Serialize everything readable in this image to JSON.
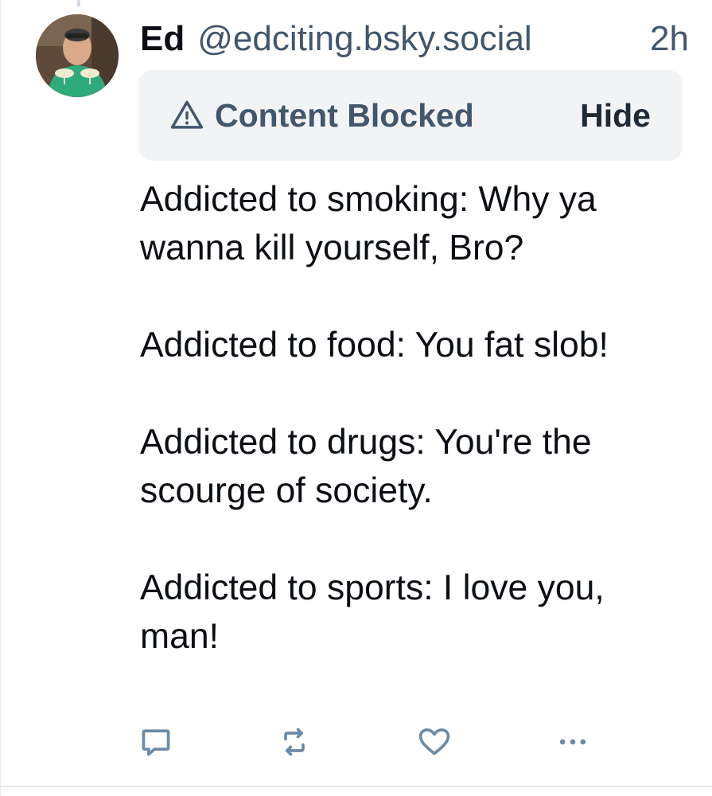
{
  "post": {
    "author": {
      "display_name": "Ed",
      "handle": "@edciting.bsky.social",
      "avatar_icon": "user-avatar-photo"
    },
    "time_ago": "2h",
    "moderation": {
      "label": "Content Blocked",
      "toggle_label": "Hide",
      "icon": "warning-triangle-icon",
      "background": "#f1f3f5",
      "text_color": "#42566c"
    },
    "paragraphs": [
      "Addicted to smoking: Why ya wanna kill yourself, Bro?",
      "Addicted to food: You fat slob!",
      "Addicted to drugs: You're the scourge of society.",
      "Addicted to sports: I love you, man!"
    ],
    "actions": [
      {
        "name": "reply",
        "icon": "reply-icon"
      },
      {
        "name": "repost",
        "icon": "repost-icon"
      },
      {
        "name": "like",
        "icon": "heart-icon"
      },
      {
        "name": "more",
        "icon": "more-options-icon"
      }
    ]
  },
  "colors": {
    "primary_text": "#0b0f14",
    "secondary_text": "#42566c",
    "icon_color": "#6b8aa6",
    "accent_blue": "#4a80d6"
  }
}
